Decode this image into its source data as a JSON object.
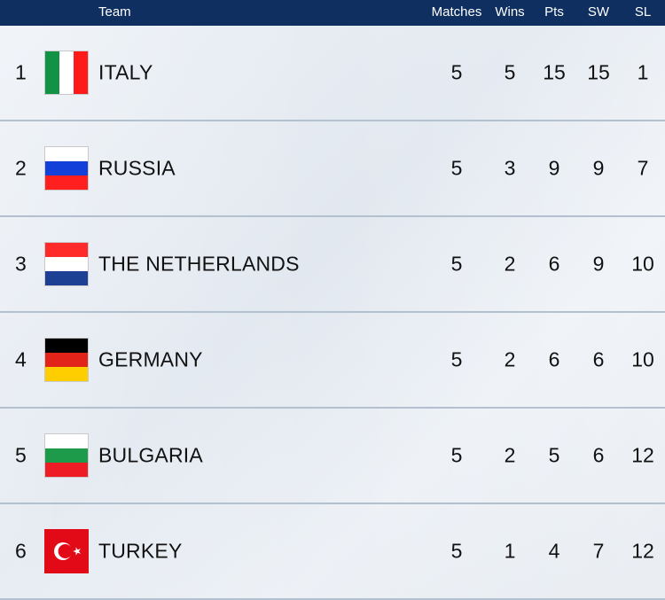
{
  "header": {
    "team": "Team",
    "matches": "Matches",
    "wins": "Wins",
    "pts": "Pts",
    "sw": "SW",
    "sl": "SL"
  },
  "rows": [
    {
      "rank": "1",
      "team": "ITALY",
      "flag": "italy-flag",
      "matches": "5",
      "wins": "5",
      "pts": "15",
      "sw": "15",
      "sl": "1"
    },
    {
      "rank": "2",
      "team": "RUSSIA",
      "flag": "russia-flag",
      "matches": "5",
      "wins": "3",
      "pts": "9",
      "sw": "9",
      "sl": "7"
    },
    {
      "rank": "3",
      "team": "THE NETHERLANDS",
      "flag": "netherlands-flag",
      "matches": "5",
      "wins": "2",
      "pts": "6",
      "sw": "9",
      "sl": "10"
    },
    {
      "rank": "4",
      "team": "GERMANY",
      "flag": "germany-flag",
      "matches": "5",
      "wins": "2",
      "pts": "6",
      "sw": "6",
      "sl": "10"
    },
    {
      "rank": "5",
      "team": "BULGARIA",
      "flag": "bulgaria-flag",
      "matches": "5",
      "wins": "2",
      "pts": "5",
      "sw": "6",
      "sl": "12"
    },
    {
      "rank": "6",
      "team": "TURKEY",
      "flag": "turkey-flag",
      "matches": "5",
      "wins": "1",
      "pts": "4",
      "sw": "7",
      "sl": "12"
    }
  ],
  "colors": {
    "header_bg": "#0e2f5f",
    "row_divider": "#b3c0cf"
  }
}
